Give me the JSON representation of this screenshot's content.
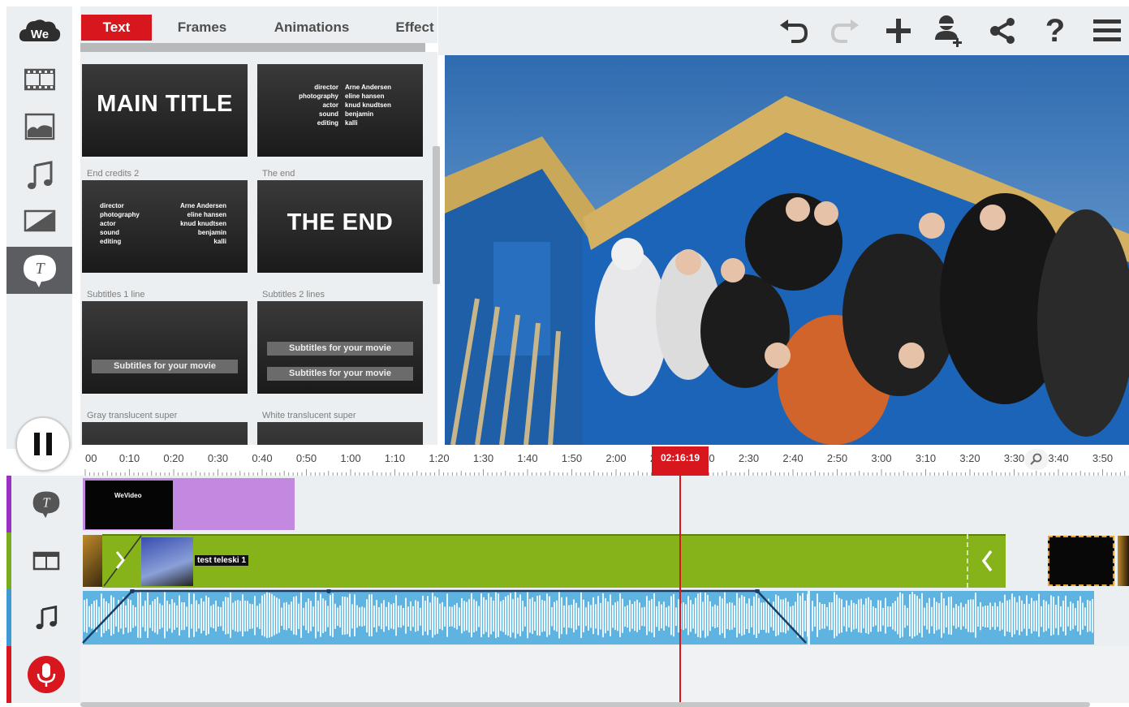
{
  "app": {
    "logo_text": "We"
  },
  "tabs": [
    {
      "label": "Text",
      "active": true
    },
    {
      "label": "Frames",
      "active": false
    },
    {
      "label": "Animations",
      "active": false
    },
    {
      "label": "Effect",
      "active": false
    }
  ],
  "left_rail": [
    {
      "icon": "film-icon",
      "label": "Video clips"
    },
    {
      "icon": "image-icon",
      "label": "Photos"
    },
    {
      "icon": "music-icon",
      "label": "Music"
    },
    {
      "icon": "transition-icon",
      "label": "Transitions"
    },
    {
      "icon": "text-bubble-icon",
      "label": "Text",
      "active": true
    }
  ],
  "toolbar": [
    {
      "icon": "undo-icon",
      "enabled": true
    },
    {
      "icon": "redo-icon",
      "enabled": false
    },
    {
      "icon": "add-icon",
      "enabled": true
    },
    {
      "icon": "add-user-icon",
      "enabled": true
    },
    {
      "icon": "share-icon",
      "enabled": true
    },
    {
      "icon": "help-icon",
      "enabled": true,
      "glyph": "?"
    },
    {
      "icon": "menu-icon",
      "enabled": true
    }
  ],
  "templates": {
    "main_title": {
      "thumb_text": "MAIN TITLE"
    },
    "end_credits_1": {
      "rows": [
        [
          "director",
          "Arne Andersen"
        ],
        [
          "photography",
          "eline hansen"
        ],
        [
          "actor",
          "knud knudtsen"
        ],
        [
          "sound",
          "benjamin"
        ],
        [
          "editing",
          "kalli"
        ]
      ]
    },
    "end_credits_2": {
      "label": "End credits 2",
      "rows": [
        [
          "director",
          "Arne Andersen"
        ],
        [
          "photography",
          "eline hansen"
        ],
        [
          "actor",
          "knud knudtsen"
        ],
        [
          "sound",
          "benjamin"
        ],
        [
          "editing",
          "kalli"
        ]
      ]
    },
    "the_end": {
      "label": "The end",
      "thumb_text": "THE END"
    },
    "subtitles_1": {
      "label": "Subtitles 1 line",
      "line1": "Subtitles for your movie"
    },
    "subtitles_2": {
      "label": "Subtitles 2 lines",
      "line1": "Subtitles for your movie",
      "line2": "Subtitles for your movie"
    },
    "gray_super": {
      "label": "Gray translucent super"
    },
    "white_super": {
      "label": "White translucent super"
    }
  },
  "timeline": {
    "ticks": [
      "00",
      "0:10",
      "0:20",
      "0:30",
      "0:40",
      "0:50",
      "1:00",
      "1:10",
      "1:20",
      "1:30",
      "1:40",
      "1:50",
      "2:00",
      "2:10",
      "2:20",
      "2:30",
      "2:40",
      "2:50",
      "3:00",
      "3:10",
      "3:20",
      "3:30",
      "3:40",
      "3:50"
    ],
    "current_time": "02:16:19",
    "text_clip_label": "WeVideo",
    "video_clip_label": "test teleski 1"
  },
  "colors": {
    "accent": "#d7161e",
    "text_track": "#9b30c7",
    "video_track": "#7aab1d",
    "audio_track": "#3e9ad4",
    "voice_track": "#d7161e",
    "clip_purple": "#c389e0",
    "clip_green": "#86b31a",
    "wave_blue": "#5fb3e0"
  }
}
